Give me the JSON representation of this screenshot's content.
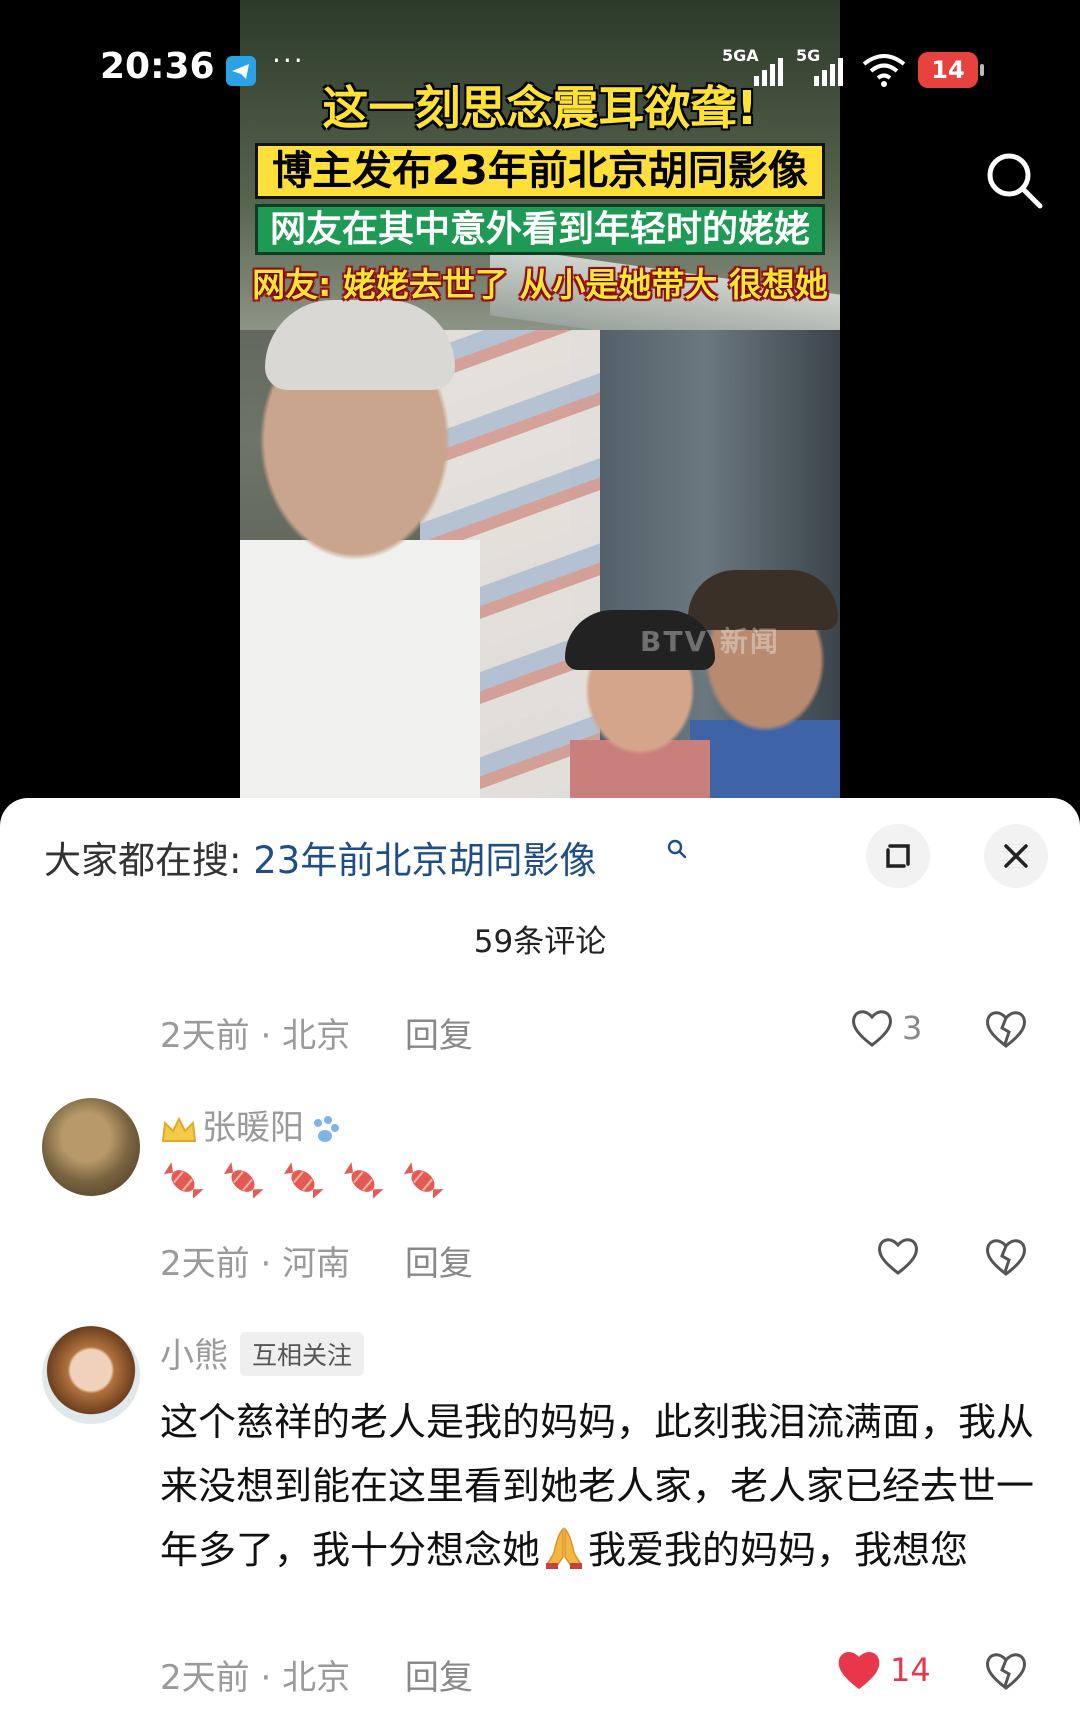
{
  "status_bar": {
    "time": "20:36",
    "network_1": "5GA",
    "network_2": "5G",
    "battery": "14"
  },
  "video": {
    "captions": [
      "这一刻思念震耳欲聋!",
      "博主发布23年前北京胡同影像",
      "网友在其中意外看到年轻时的姥姥",
      "网友: 姥姥去世了 从小是她带大 很想她"
    ],
    "watermark": "BTV 新闻"
  },
  "sheet": {
    "search_prefix": "大家都在搜:",
    "search_query": "23年前北京胡同影像",
    "comment_count": "59条评论"
  },
  "comments": [
    {
      "time": "2天前",
      "location": "北京",
      "reply": "回复",
      "likes": "3"
    },
    {
      "username": "张暖阳",
      "content_emoji": "candy x5",
      "time": "2天前",
      "location": "河南",
      "reply": "回复",
      "likes": ""
    },
    {
      "username": "小熊",
      "badge": "互相关注",
      "text_a": "这个慈祥的老人是我的妈妈，此刻我泪流满面，我从来没想到能在这里看到她老人家，老人家已经去世一年多了，我十分想念她",
      "text_b": "我爱我的妈妈，我想您",
      "time": "2天前",
      "location": "北京",
      "reply": "回复",
      "likes": "14",
      "liked": true
    }
  ],
  "colors": {
    "like_active": "#e8364b",
    "link": "#1f4e86",
    "muted": "#9a9a9a"
  },
  "icons": [
    "telegram-icon",
    "search-icon",
    "expand-icon",
    "close-icon",
    "heart-icon",
    "broken-heart-icon",
    "crown-icon",
    "paw-icon",
    "candy-icon",
    "pray-icon"
  ]
}
